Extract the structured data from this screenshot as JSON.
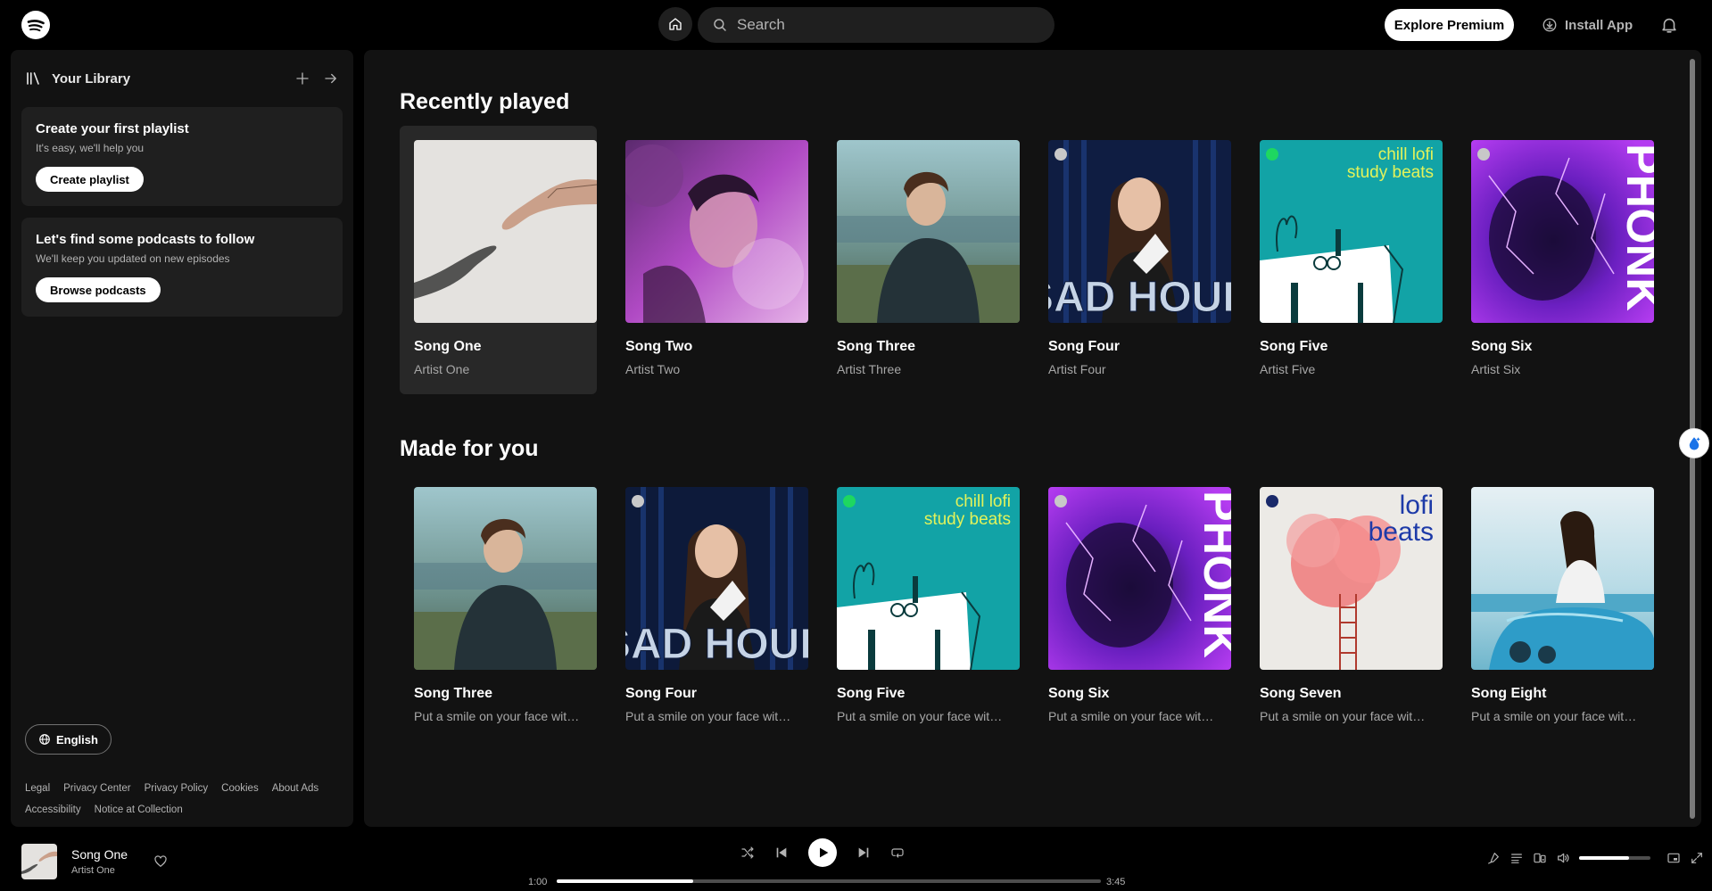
{
  "header": {
    "search_placeholder": "Search",
    "explore_premium": "Explore Premium",
    "install_app": "Install App"
  },
  "sidebar": {
    "title": "Your Library",
    "playlist_card": {
      "title": "Create your first playlist",
      "subtitle": "It's easy, we'll help you",
      "button": "Create playlist"
    },
    "podcast_card": {
      "title": "Let's find some podcasts to follow",
      "subtitle": "We'll keep you updated on new episodes",
      "button": "Browse podcasts"
    },
    "language": "English",
    "legal_links": [
      "Legal",
      "Privacy Center",
      "Privacy Policy",
      "Cookies",
      "About Ads",
      "Accessibility",
      "Notice at Collection"
    ]
  },
  "sections": {
    "recent": {
      "title": "Recently played",
      "items": [
        {
          "title": "Song One",
          "subtitle": "Artist One"
        },
        {
          "title": "Song Two",
          "subtitle": "Artist Two"
        },
        {
          "title": "Song Three",
          "subtitle": "Artist Three"
        },
        {
          "title": "Song Four",
          "subtitle": "Artist Four"
        },
        {
          "title": "Song Five",
          "subtitle": "Artist Five"
        },
        {
          "title": "Song Six",
          "subtitle": "Artist Six"
        }
      ]
    },
    "made": {
      "title": "Made for you",
      "items": [
        {
          "title": "Song Three",
          "subtitle": "Put a smile on your face with t…"
        },
        {
          "title": "Song Four",
          "subtitle": "Put a smile on your face with t…"
        },
        {
          "title": "Song Five",
          "subtitle": "Put a smile on your face with t…"
        },
        {
          "title": "Song Six",
          "subtitle": "Put a smile on your face with t…"
        },
        {
          "title": "Song Seven",
          "subtitle": "Put a smile on your face with t…"
        },
        {
          "title": "Song Eight",
          "subtitle": "Put a smile on your face with t…"
        }
      ]
    }
  },
  "covers": {
    "sad_hour": "SAD HOUR",
    "chill_lofi": "chill lofi",
    "study_beats": "study beats",
    "phonk": "PHONK",
    "lofi": "lofi",
    "beats": "beats"
  },
  "player": {
    "title": "Song One",
    "artist": "Artist One",
    "current_time": "1:00",
    "total_time": "3:45",
    "progress": 0.25,
    "volume": 0.7
  },
  "colors": {
    "background": "#000000",
    "panel": "#121212",
    "card": "#1f1f1f",
    "spotify_green": "#1ed760"
  }
}
